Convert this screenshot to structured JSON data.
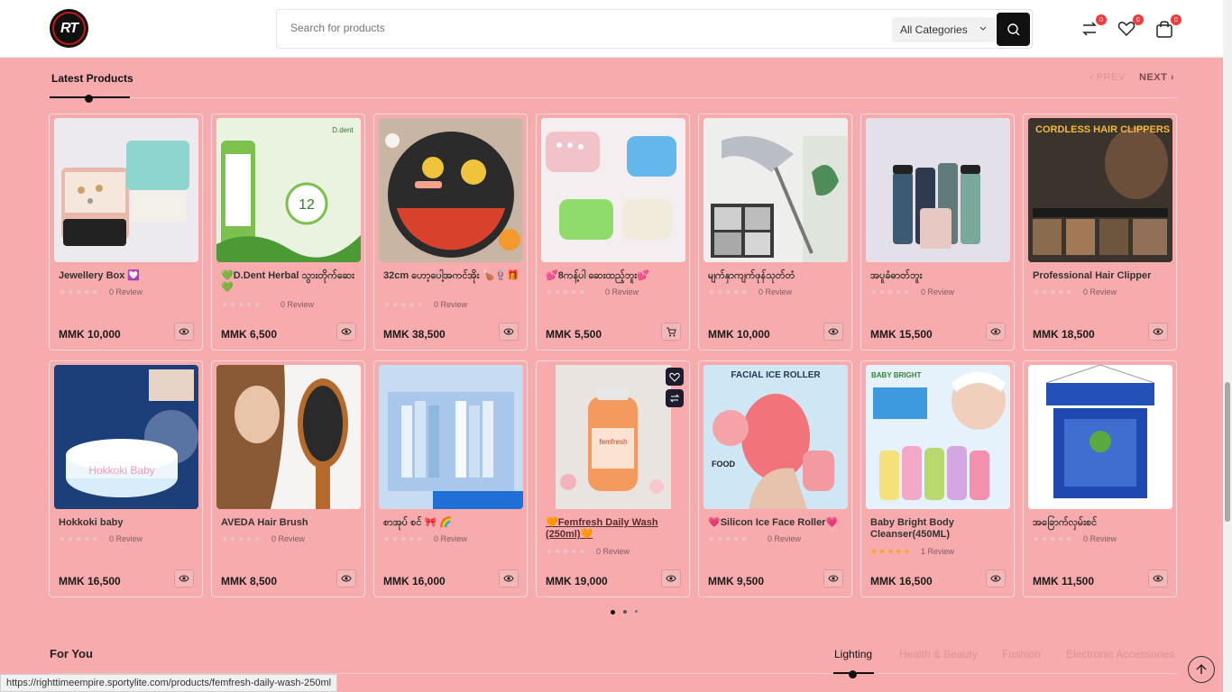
{
  "header": {
    "logo_text": "RT",
    "search_placeholder": "Search for products",
    "category": "All Categories",
    "compare_count": "0",
    "wishlist_count": "0",
    "cart_count": "0"
  },
  "latest": {
    "title": "Latest Products",
    "prev": "PREV",
    "next": "NEXT"
  },
  "products": [
    {
      "name": "Jewellery Box 💟",
      "rating": "0 Review",
      "price": "MMK 10,000"
    },
    {
      "name": "💚D.Dent Herbal သွားတိုက်ဆေး💚",
      "rating": "0 Review",
      "price": "MMK 6,500"
    },
    {
      "name": "32cm ဟော့ပေါ့အကင်အိုး 🍗🪢🎁",
      "rating": "0 Review",
      "price": "MMK 38,500"
    },
    {
      "name": "💕8ကန့်ပါ ဆေးထည့်ဘူး💕",
      "rating": "0 Review",
      "price": "MMK 5,500"
    },
    {
      "name": "မျက်နှာကျက်ဖုန်သုတ်တံ",
      "rating": "0 Review",
      "price": "MMK 10,000"
    },
    {
      "name": "အပူခံဓာတ်ဘူး",
      "rating": "0 Review",
      "price": "MMK 15,500"
    },
    {
      "name": "Professional Hair Clipper",
      "rating": "0 Review",
      "price": "MMK 18,500"
    },
    {
      "name": "Hokkoki baby",
      "rating": "0 Review",
      "price": "MMK 16,500"
    },
    {
      "name": "AVEDA Hair Brush",
      "rating": "0 Review",
      "price": "MMK 8,500"
    },
    {
      "name": "စာအုပ် စင် 🎀 🌈",
      "rating": "0 Review",
      "price": "MMK 16,000"
    },
    {
      "name": "🧡Femfresh Daily Wash (250ml)🧡",
      "rating": "0 Review",
      "price": "MMK 19,000"
    },
    {
      "name": "💗Silicon Ice Face Roller💗",
      "rating": "0 Review",
      "price": "MMK 9,500"
    },
    {
      "name": "Baby Bright Body Cleanser(450ML)",
      "rating": "1 Review",
      "price": "MMK 16,500"
    },
    {
      "name": "အခြောက်လှမ်းစင်",
      "rating": "0 Review",
      "price": "MMK 11,500"
    }
  ],
  "image_texts": {
    "ddent": "D.dent",
    "hair_title": "CORDLESS HAIR CLIPPERS",
    "hokkoki": "Hokkoki Baby",
    "femfresh": "femfresh",
    "roller_title": "FACIAL ICE ROLLER",
    "roller_food": "FOOD",
    "bright_brand": "BABY BRIGHT"
  },
  "for_you": {
    "title": "For You",
    "tabs": [
      "Lighting",
      "Health & Beauty",
      "Fashion",
      "Electronic Accessories"
    ]
  },
  "status_url": "https://righttimeempire.sportylite.com/products/femfresh-daily-wash-250ml",
  "colors": {
    "background": "#f7abad",
    "accent": "#111111",
    "badge": "#ef3b3b",
    "star_filled": "#f4a81a"
  }
}
